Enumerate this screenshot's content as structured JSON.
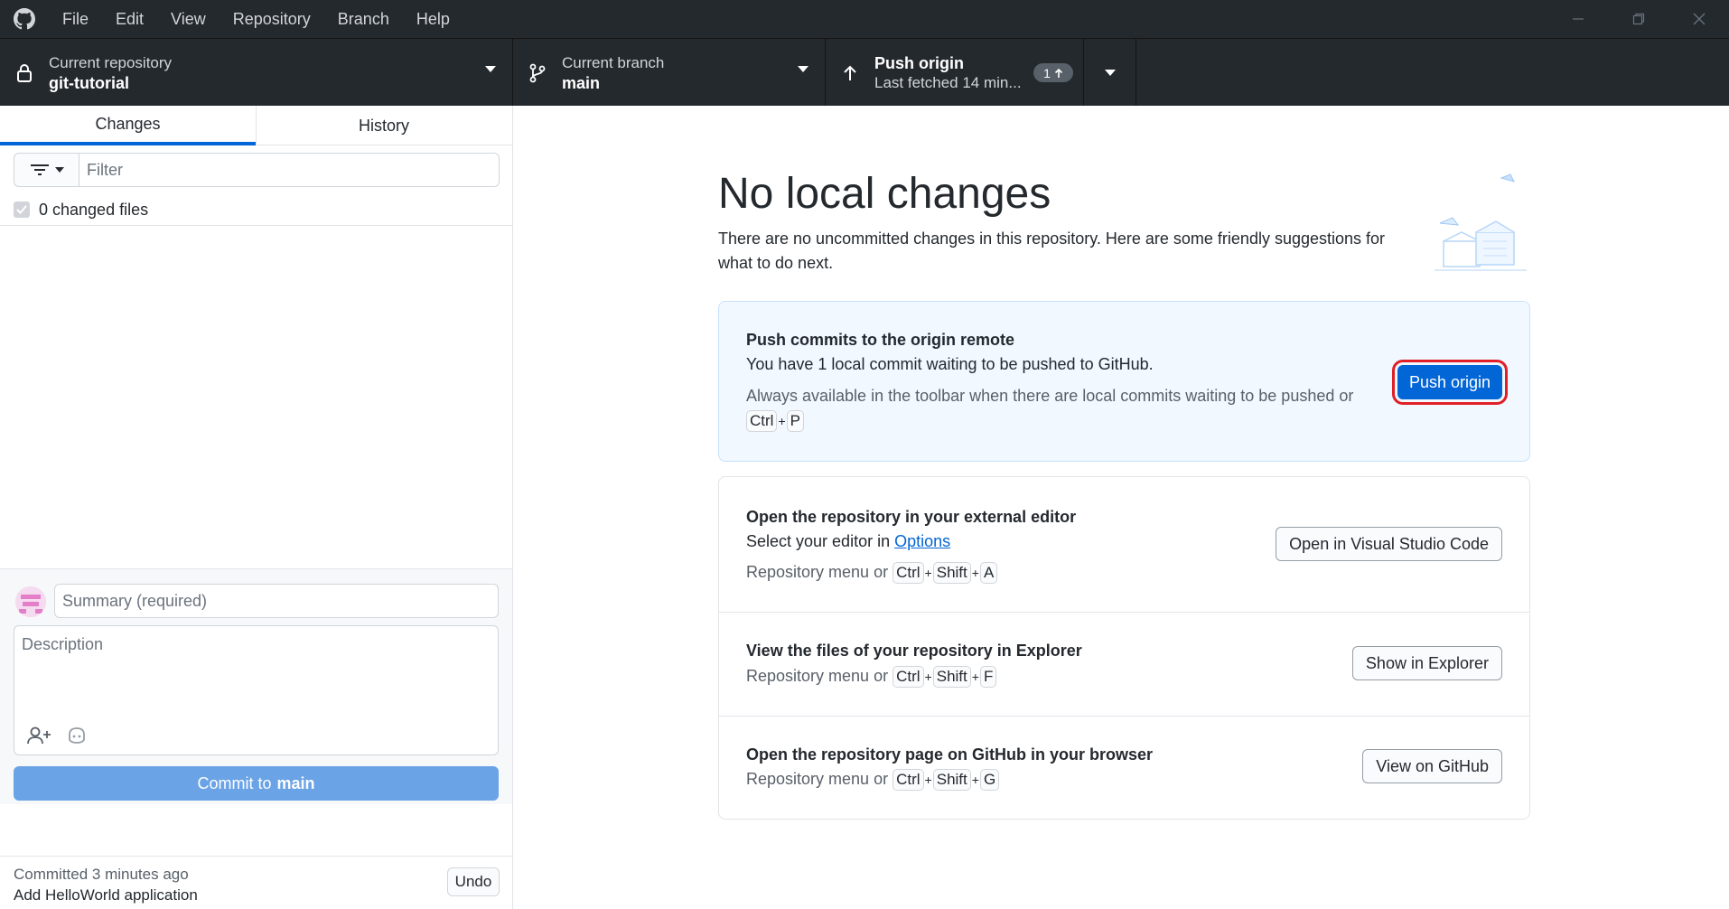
{
  "menu": [
    "File",
    "Edit",
    "View",
    "Repository",
    "Branch",
    "Help"
  ],
  "toolbar": {
    "repo_label": "Current repository",
    "repo_name": "git-tutorial",
    "branch_label": "Current branch",
    "branch_name": "main",
    "push_title": "Push origin",
    "push_subtitle": "Last fetched 14 min...",
    "push_badge_count": "1"
  },
  "sidebar": {
    "tabs": [
      "Changes",
      "History"
    ],
    "active_tab": "Changes",
    "filter_placeholder": "Filter",
    "changed_files": "0 changed files",
    "summary_placeholder": "Summary (required)",
    "description_placeholder": "Description",
    "commit_prefix": "Commit to",
    "commit_branch": "main",
    "last_commit_time": "Committed 3 minutes ago",
    "last_commit_message": "Add HelloWorld application",
    "undo_label": "Undo"
  },
  "main": {
    "heading": "No local changes",
    "subtext": "There are no uncommitted changes in this repository. Here are some friendly suggestions for what to do next.",
    "push_card": {
      "title": "Push commits to the origin remote",
      "line": "You have 1 local commit waiting to be pushed to GitHub.",
      "hint": "Always available in the toolbar when there are local commits waiting to be pushed or",
      "keys": [
        "Ctrl",
        "P"
      ],
      "button": "Push origin"
    },
    "suggestions": [
      {
        "title": "Open the repository in your external editor",
        "line_prefix": "Select your editor in",
        "line_link": "Options",
        "hint": "Repository menu or",
        "keys": [
          "Ctrl",
          "Shift",
          "A"
        ],
        "button": "Open in Visual Studio Code"
      },
      {
        "title": "View the files of your repository in Explorer",
        "hint": "Repository menu or",
        "keys": [
          "Ctrl",
          "Shift",
          "F"
        ],
        "button": "Show in Explorer"
      },
      {
        "title": "Open the repository page on GitHub in your browser",
        "hint": "Repository menu or",
        "keys": [
          "Ctrl",
          "Shift",
          "G"
        ],
        "button": "View on GitHub"
      }
    ]
  },
  "colors": {
    "titlebar_bg": "#24292e",
    "accent_blue": "#0366d6",
    "highlight_red": "#e01f26",
    "commit_button_disabled": "#6aa3e6"
  }
}
